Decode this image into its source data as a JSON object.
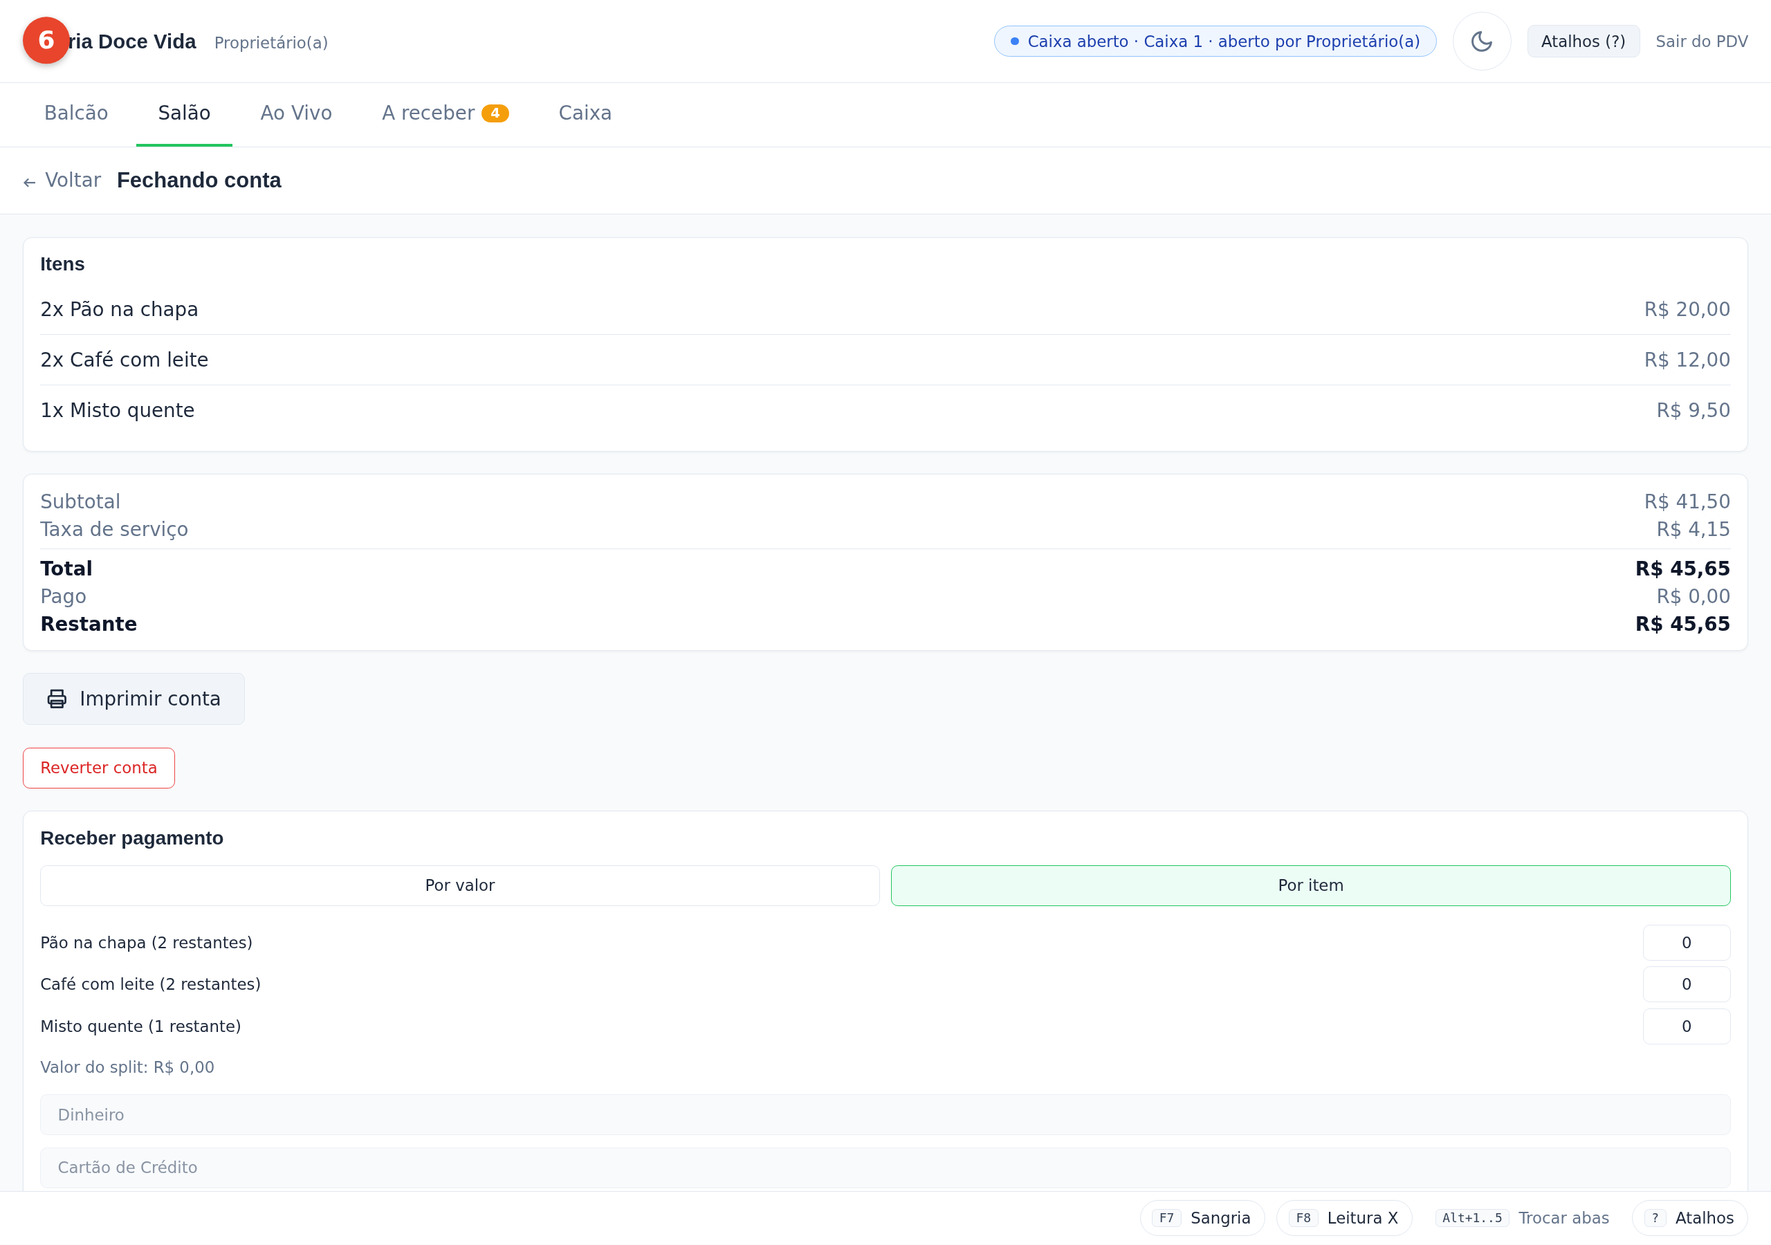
{
  "header": {
    "notification_count": "6",
    "brand": "ria Doce Vida",
    "role": "Proprietário(a)",
    "status": "Caixa aberto · Caixa 1 · aberto por Proprietário(a)",
    "shortcuts_button": "Atalhos (?)",
    "exit_link": "Sair do PDV"
  },
  "tabs": [
    {
      "label": "Balcão",
      "selected": false
    },
    {
      "label": "Salão",
      "selected": true
    },
    {
      "label": "Ao Vivo",
      "selected": false
    },
    {
      "label": "A receber",
      "badge": "4",
      "selected": false
    },
    {
      "label": "Caixa",
      "selected": false
    }
  ],
  "breadcrumb": {
    "back": "Voltar",
    "title": "Fechando conta"
  },
  "items_card": {
    "title": "Itens",
    "items": [
      {
        "name": "2x Pão na chapa",
        "price": "R$ 20,00"
      },
      {
        "name": "2x Café com leite",
        "price": "R$ 12,00"
      },
      {
        "name": "1x Misto quente",
        "price": "R$ 9,50"
      }
    ]
  },
  "totals": [
    {
      "label": "Subtotal",
      "value": "R$ 41,50",
      "kind": "muted"
    },
    {
      "label": "Taxa de serviço",
      "value": "R$ 4,15",
      "kind": "muted"
    },
    {
      "label": "Total",
      "value": "R$ 45,65",
      "kind": "strong"
    },
    {
      "label": "Pago",
      "value": "R$ 0,00",
      "kind": "muted"
    },
    {
      "label": "Restante",
      "value": "R$ 45,65",
      "kind": "strong"
    }
  ],
  "print_button": "Imprimir conta",
  "revert_button": "Reverter conta",
  "payment": {
    "title": "Receber pagamento",
    "modes": [
      {
        "label": "Por valor",
        "selected": false
      },
      {
        "label": "Por item",
        "selected": true
      }
    ],
    "split_items": [
      {
        "label": "Pão na chapa (2 restantes)",
        "quantity": "0"
      },
      {
        "label": "Café com leite (2 restantes)",
        "quantity": "0"
      },
      {
        "label": "Misto quente (1 restante)",
        "quantity": "0"
      }
    ],
    "split_value": "Valor do split: R$ 0,00",
    "methods": [
      "Dinheiro",
      "Cartão de Crédito"
    ]
  },
  "footer": [
    {
      "key": "F7",
      "label": "Sangria",
      "kind": "chip"
    },
    {
      "key": "F8",
      "label": "Leitura X",
      "kind": "chip"
    },
    {
      "key": "Alt+1..5",
      "label": "Trocar abas",
      "kind": "hint"
    },
    {
      "key": "?",
      "label": "Atalhos",
      "kind": "chip"
    }
  ]
}
